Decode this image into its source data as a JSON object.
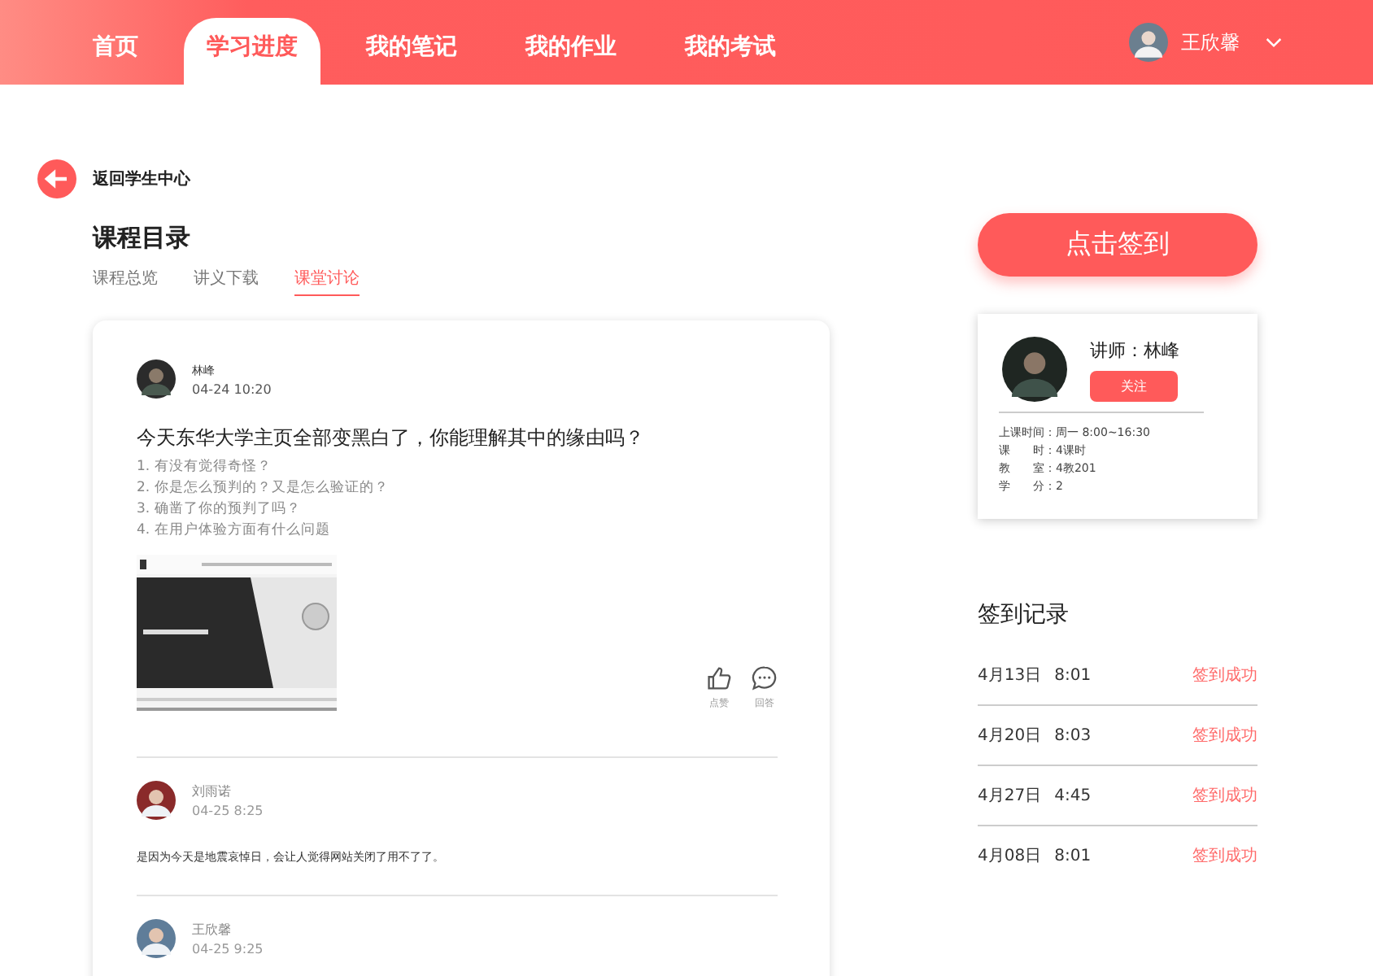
{
  "nav": {
    "tabs": [
      {
        "label": "首页",
        "selected": false
      },
      {
        "label": "学习进度",
        "selected": true
      },
      {
        "label": "我的笔记",
        "selected": false
      },
      {
        "label": "我的作业",
        "selected": false
      },
      {
        "label": "我的考试",
        "selected": false
      }
    ],
    "user": {
      "name": "王欣馨"
    }
  },
  "back": {
    "label": "返回学生中心"
  },
  "course": {
    "title": "课程目录",
    "tabs": [
      {
        "label": "课程总览",
        "selected": false
      },
      {
        "label": "讲义下载",
        "selected": false
      },
      {
        "label": "课堂讨论",
        "selected": true
      }
    ]
  },
  "post": {
    "author": "林峰",
    "time": "04-24 10:20",
    "title": "今天东华大学主页全部变黑白了，你能理解其中的缘由吗？",
    "points": [
      "1. 有没有觉得奇怪？",
      "2. 你是怎么预判的？又是怎么验证的？",
      "3. 确凿了你的预判了吗？",
      "4. 在用户体验方面有什么问题"
    ],
    "like_label": "点赞",
    "reply_label": "回答"
  },
  "comments": [
    {
      "author": "刘雨诺",
      "time": "04-25 8:25",
      "text": "是因为今天是地震哀悼日，会让人觉得网站关闭了用不了了。"
    },
    {
      "author": "王欣馨",
      "time": "04-25 9:25"
    }
  ],
  "checkin_button": "点击签到",
  "teacher": {
    "title": "讲师：林峰",
    "follow": "关注",
    "info": [
      {
        "label": "上课时间：",
        "value": "周一 8:00~16:30"
      },
      {
        "label": "课　　时：",
        "value": "4课时"
      },
      {
        "label": "教　　室：",
        "value": "4教201"
      },
      {
        "label": "学　　分：",
        "value": "2"
      }
    ]
  },
  "records": {
    "title": "签到记录",
    "rows": [
      {
        "date": "4月13日",
        "time": "8:01",
        "status": "签到成功"
      },
      {
        "date": "4月20日",
        "time": "8:03",
        "status": "签到成功"
      },
      {
        "date": "4月27日",
        "time": "4:45",
        "status": "签到成功"
      },
      {
        "date": "4月08日",
        "time": "8:01",
        "status": "签到成功"
      }
    ]
  }
}
